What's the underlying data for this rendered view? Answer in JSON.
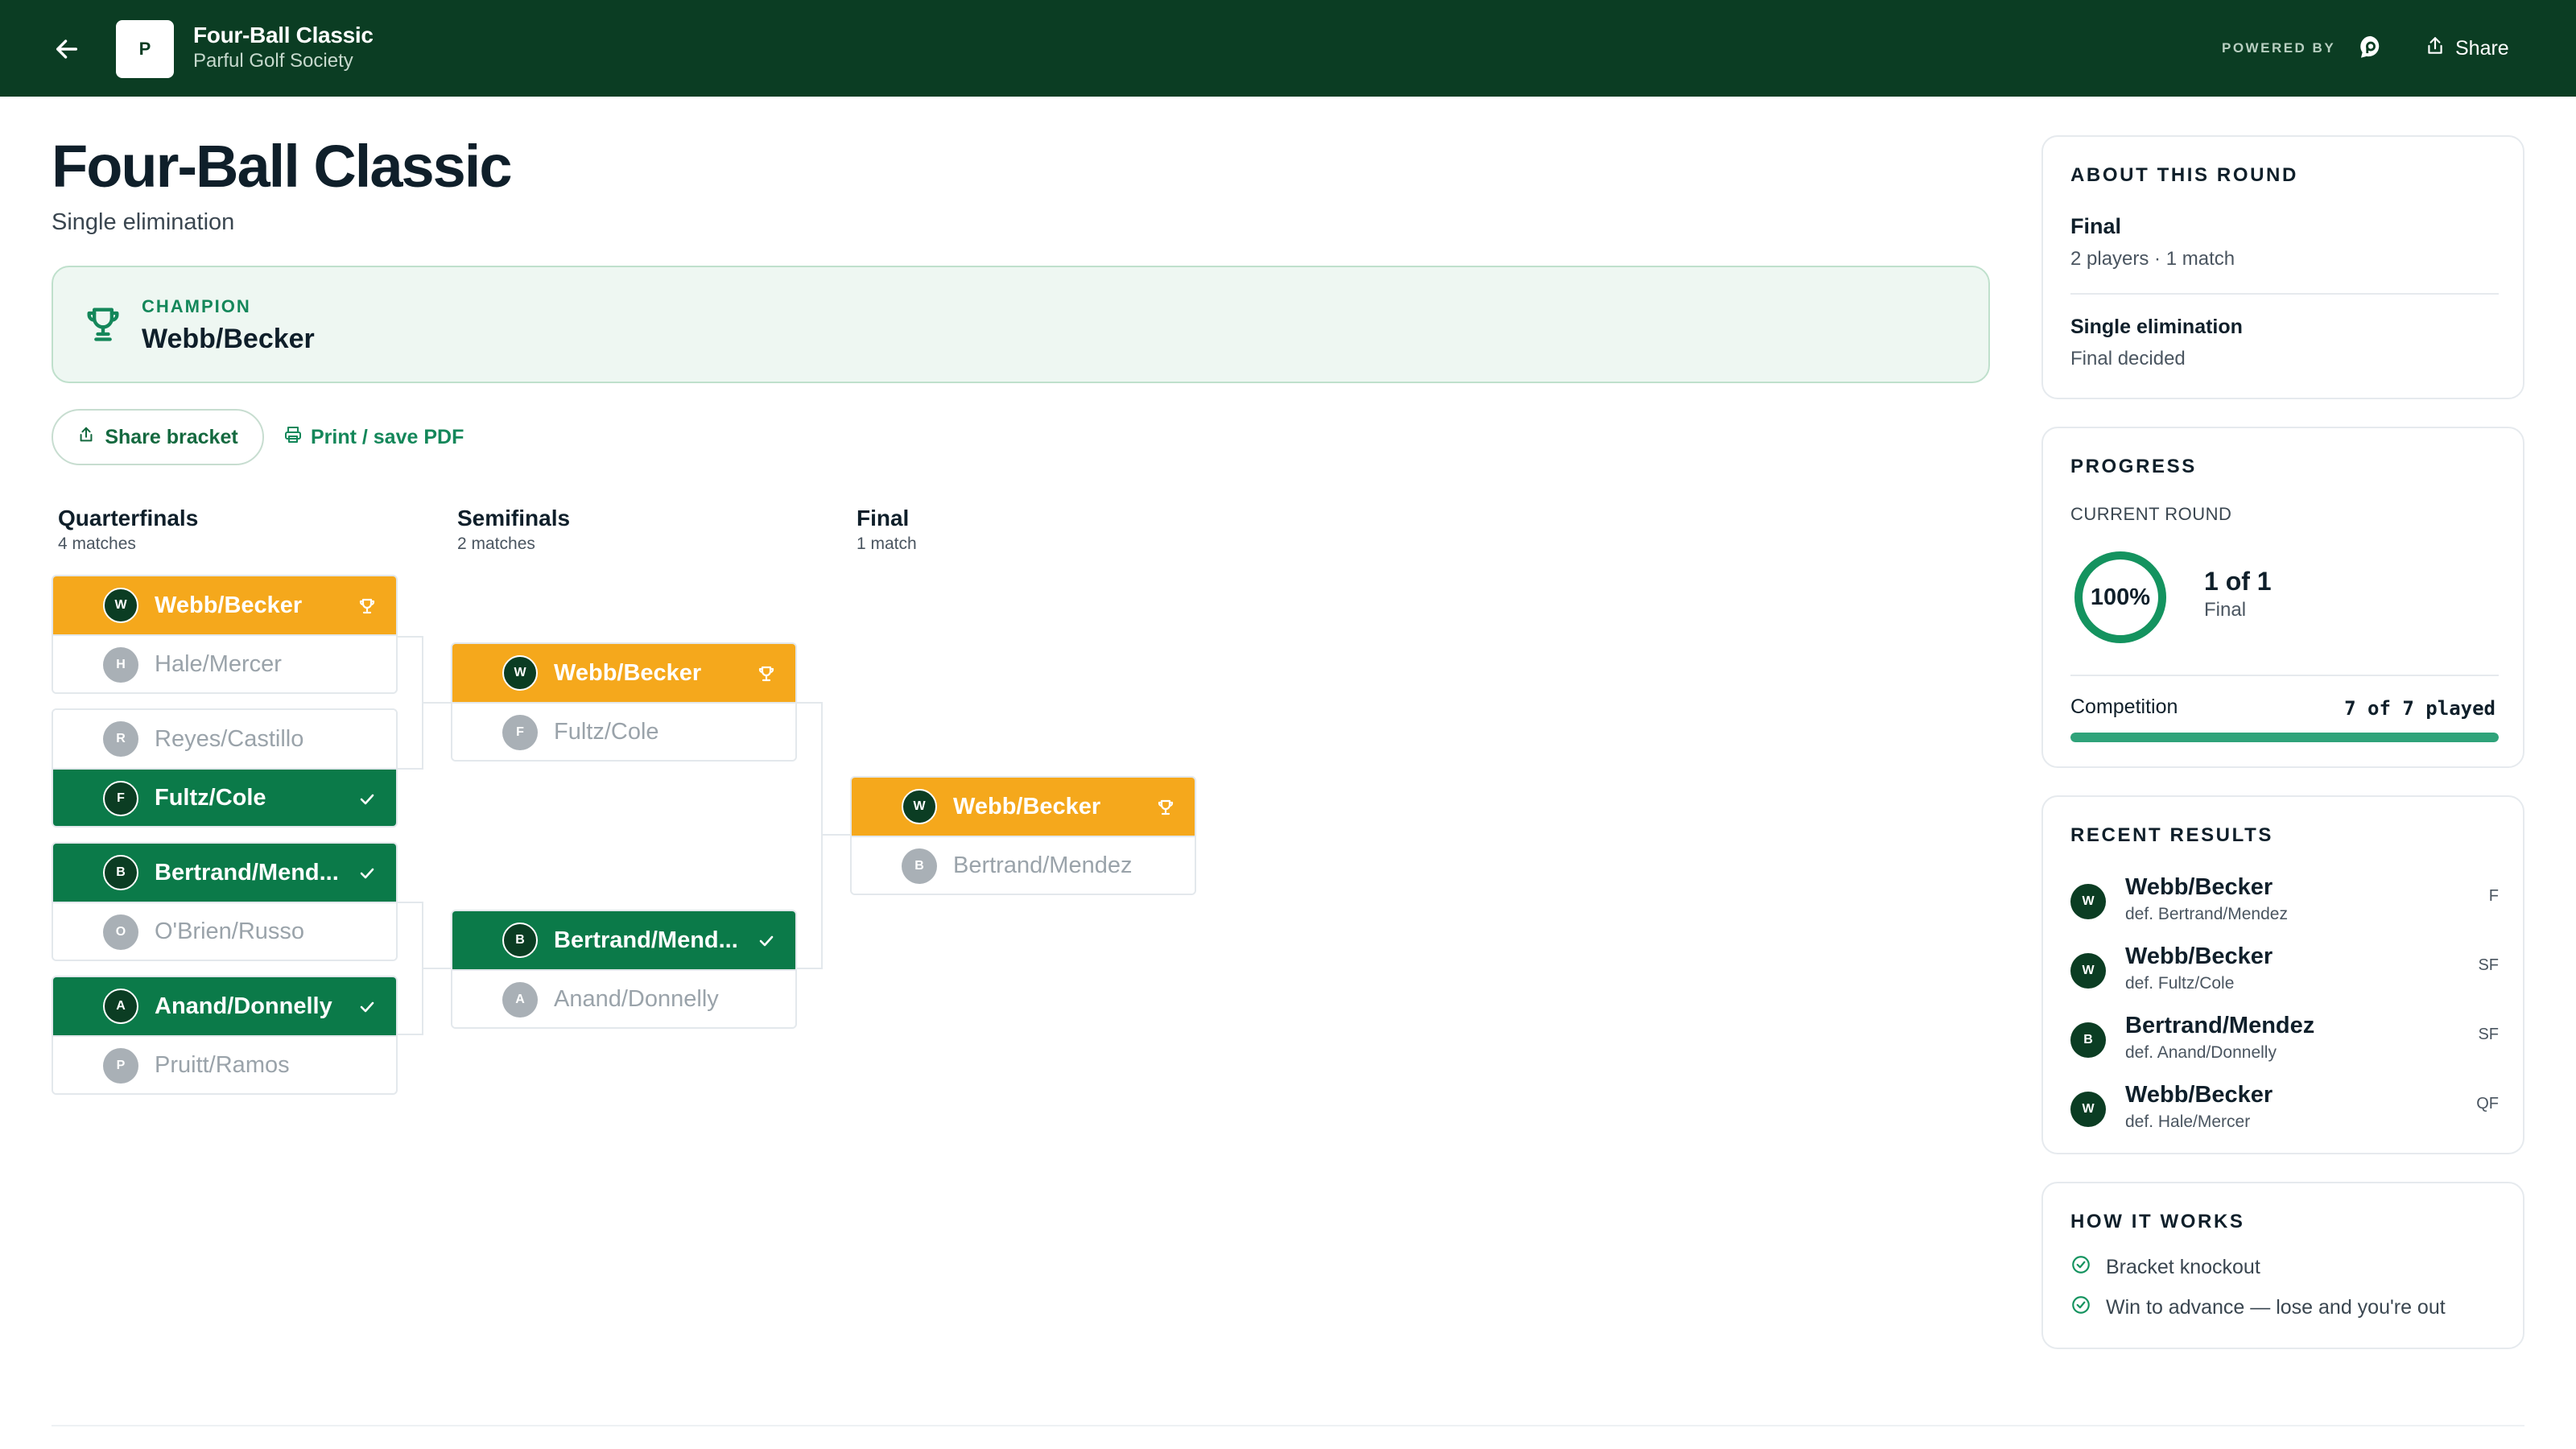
{
  "topbar": {
    "logo_letter": "P",
    "title": "Four-Ball Classic",
    "subtitle": "Parful Golf Society",
    "powered_by": "POWERED BY",
    "share_label": "Share"
  },
  "header": {
    "title": "Four-Ball Classic",
    "format": "Single elimination"
  },
  "champion": {
    "label": "CHAMPION",
    "name": "Webb/Becker"
  },
  "actions": {
    "share_bracket": "Share bracket",
    "print": "Print / save PDF"
  },
  "colors": {
    "brand_dark": "#0b3d23",
    "winner_gold": "#f5a81c",
    "winner_green": "#0b7a49",
    "accent": "#14875a",
    "progress": "#2fa37a"
  },
  "bracket": {
    "rounds": [
      {
        "name": "Quarterfinals",
        "count": "4 matches",
        "matches": [
          {
            "players": [
              {
                "initial": "W",
                "name": "Webb/Becker",
                "status": "champion"
              },
              {
                "initial": "H",
                "name": "Hale/Mercer",
                "status": "lost"
              }
            ]
          },
          {
            "players": [
              {
                "initial": "R",
                "name": "Reyes/Castillo",
                "status": "lost"
              },
              {
                "initial": "F",
                "name": "Fultz/Cole",
                "status": "won"
              }
            ]
          },
          {
            "players": [
              {
                "initial": "B",
                "name": "Bertrand/Mend...",
                "status": "won"
              },
              {
                "initial": "O",
                "name": "O'Brien/Russo",
                "status": "lost"
              }
            ]
          },
          {
            "players": [
              {
                "initial": "A",
                "name": "Anand/Donnelly",
                "status": "won"
              },
              {
                "initial": "P",
                "name": "Pruitt/Ramos",
                "status": "lost"
              }
            ]
          }
        ]
      },
      {
        "name": "Semifinals",
        "count": "2 matches",
        "matches": [
          {
            "players": [
              {
                "initial": "W",
                "name": "Webb/Becker",
                "status": "champion"
              },
              {
                "initial": "F",
                "name": "Fultz/Cole",
                "status": "lost"
              }
            ]
          },
          {
            "players": [
              {
                "initial": "B",
                "name": "Bertrand/Mend...",
                "status": "won"
              },
              {
                "initial": "A",
                "name": "Anand/Donnelly",
                "status": "lost"
              }
            ]
          }
        ]
      },
      {
        "name": "Final",
        "count": "1 match",
        "matches": [
          {
            "players": [
              {
                "initial": "W",
                "name": "Webb/Becker",
                "status": "champion"
              },
              {
                "initial": "B",
                "name": "Bertrand/Mendez",
                "status": "lost"
              }
            ]
          }
        ]
      }
    ]
  },
  "about": {
    "heading": "ABOUT THIS ROUND",
    "round": "Final",
    "round_meta": "2 players · 1 match",
    "format": "Single elimination",
    "status": "Final decided"
  },
  "progress": {
    "heading": "PROGRESS",
    "current_label": "CURRENT ROUND",
    "percent_label": "100%",
    "percent": 1.0,
    "round_of": "1 of 1",
    "round_name": "Final",
    "competition_label": "Competition",
    "played": "7 of 7 played",
    "played_fraction": 1.0
  },
  "recent": {
    "heading": "RECENT RESULTS",
    "items": [
      {
        "initial": "W",
        "winner": "Webb/Becker",
        "detail": "def. Bertrand/Mendez",
        "round": "F"
      },
      {
        "initial": "W",
        "winner": "Webb/Becker",
        "detail": "def. Fultz/Cole",
        "round": "SF"
      },
      {
        "initial": "B",
        "winner": "Bertrand/Mendez",
        "detail": "def. Anand/Donnelly",
        "round": "SF"
      },
      {
        "initial": "W",
        "winner": "Webb/Becker",
        "detail": "def. Hale/Mercer",
        "round": "QF"
      }
    ]
  },
  "how": {
    "heading": "HOW IT WORKS",
    "items": [
      "Bracket knockout",
      "Win to advance — lose and you're out"
    ]
  }
}
